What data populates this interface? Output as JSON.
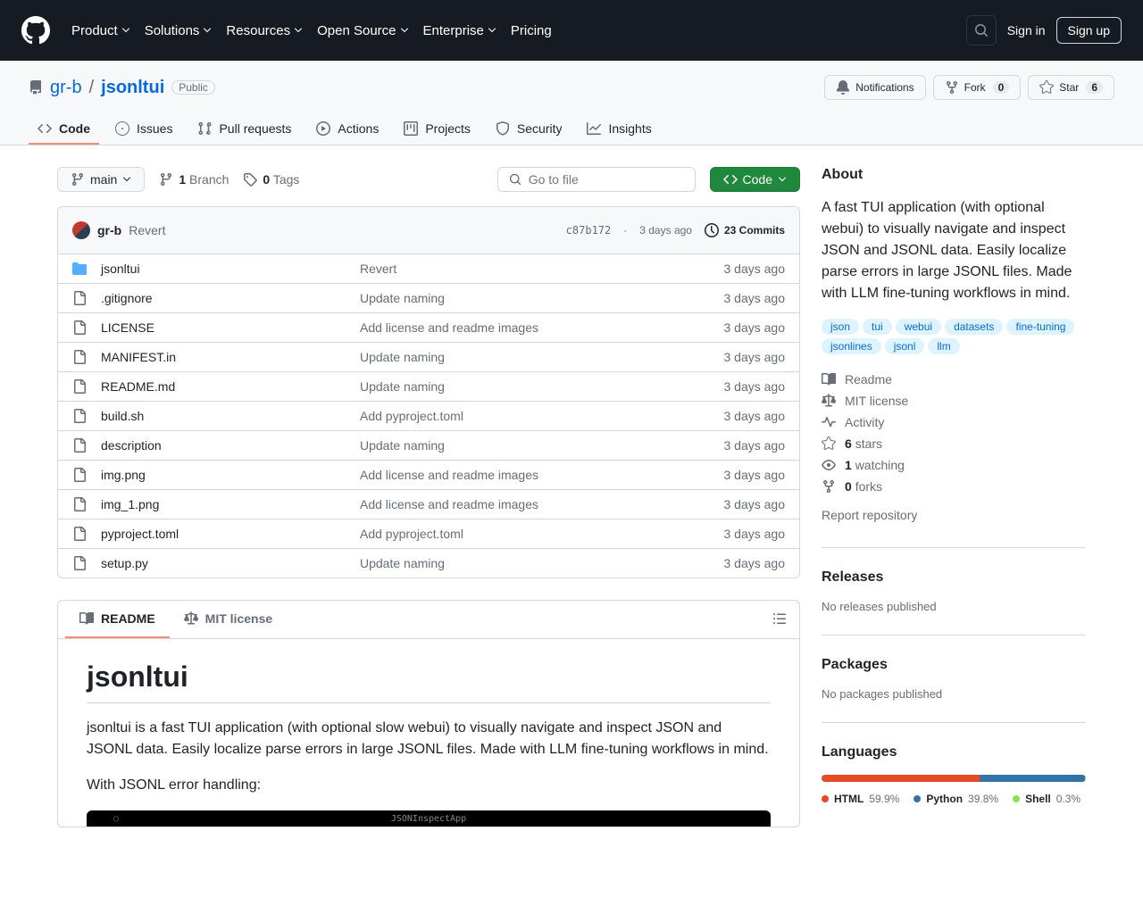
{
  "header": {
    "nav": [
      "Product",
      "Solutions",
      "Resources",
      "Open Source",
      "Enterprise",
      "Pricing"
    ],
    "signin": "Sign in",
    "signup": "Sign up"
  },
  "repo": {
    "owner": "gr-b",
    "name": "jsonltui",
    "visibility": "Public",
    "notifications": "Notifications",
    "fork": "Fork",
    "fork_count": "0",
    "star": "Star",
    "star_count": "6"
  },
  "tabs": [
    {
      "label": "Code",
      "active": true,
      "icon": "code"
    },
    {
      "label": "Issues",
      "icon": "issue"
    },
    {
      "label": "Pull requests",
      "icon": "pr"
    },
    {
      "label": "Actions",
      "icon": "play"
    },
    {
      "label": "Projects",
      "icon": "project"
    },
    {
      "label": "Security",
      "icon": "shield"
    },
    {
      "label": "Insights",
      "icon": "graph"
    }
  ],
  "file_nav": {
    "branch": "main",
    "branch_count": "1",
    "branch_label": "Branch",
    "tag_count": "0",
    "tag_label": "Tags",
    "search_placeholder": "Go to file",
    "code_btn": "Code"
  },
  "latest_commit": {
    "author": "gr-b",
    "message": "Revert",
    "hash": "c87b172",
    "date": "3 days ago",
    "commits_count": "23 Commits"
  },
  "files": [
    {
      "type": "dir",
      "name": "jsonltui",
      "msg": "Revert",
      "date": "3 days ago"
    },
    {
      "type": "file",
      "name": ".gitignore",
      "msg": "Update naming",
      "date": "3 days ago"
    },
    {
      "type": "file",
      "name": "LICENSE",
      "msg": "Add license and readme images",
      "date": "3 days ago"
    },
    {
      "type": "file",
      "name": "MANIFEST.in",
      "msg": "Update naming",
      "date": "3 days ago"
    },
    {
      "type": "file",
      "name": "README.md",
      "msg": "Update naming",
      "date": "3 days ago"
    },
    {
      "type": "file",
      "name": "build.sh",
      "msg": "Add pyproject.toml",
      "date": "3 days ago"
    },
    {
      "type": "file",
      "name": "description",
      "msg": "Update naming",
      "date": "3 days ago"
    },
    {
      "type": "file",
      "name": "img.png",
      "msg": "Add license and readme images",
      "date": "3 days ago"
    },
    {
      "type": "file",
      "name": "img_1.png",
      "msg": "Add license and readme images",
      "date": "3 days ago"
    },
    {
      "type": "file",
      "name": "pyproject.toml",
      "msg": "Add pyproject.toml",
      "date": "3 days ago"
    },
    {
      "type": "file",
      "name": "setup.py",
      "msg": "Update naming",
      "date": "3 days ago"
    }
  ],
  "readme_tabs": {
    "readme": "README",
    "license": "MIT license"
  },
  "readme": {
    "title": "jsonltui",
    "p1": "jsonltui is a fast TUI application (with optional slow webui) to visually navigate and inspect JSON and JSONL data. Easily localize parse errors in large JSONL files. Made with LLM fine-tuning workflows in mind.",
    "p2": "With JSONL error handling:",
    "terminal_title": "JSONInspectApp"
  },
  "sidebar": {
    "about_title": "About",
    "about_text": "A fast TUI application (with optional webui) to visually navigate and inspect JSON and JSONL data. Easily localize parse errors in large JSONL files. Made with LLM fine-tuning workflows in mind.",
    "topics": [
      "json",
      "tui",
      "webui",
      "datasets",
      "fine-tuning",
      "jsonlines",
      "jsonl",
      "llm"
    ],
    "readme": "Readme",
    "license": "MIT license",
    "activity": "Activity",
    "stars_n": "6",
    "stars_t": "stars",
    "watching_n": "1",
    "watching_t": "watching",
    "forks_n": "0",
    "forks_t": "forks",
    "report": "Report repository",
    "releases_title": "Releases",
    "releases_text": "No releases published",
    "packages_title": "Packages",
    "packages_text": "No packages published",
    "languages_title": "Languages",
    "languages": [
      {
        "name": "HTML",
        "pct": "59.9%",
        "color": "#e34c26"
      },
      {
        "name": "Python",
        "pct": "39.8%",
        "color": "#3572A5"
      },
      {
        "name": "Shell",
        "pct": "0.3%",
        "color": "#89e051"
      }
    ]
  }
}
